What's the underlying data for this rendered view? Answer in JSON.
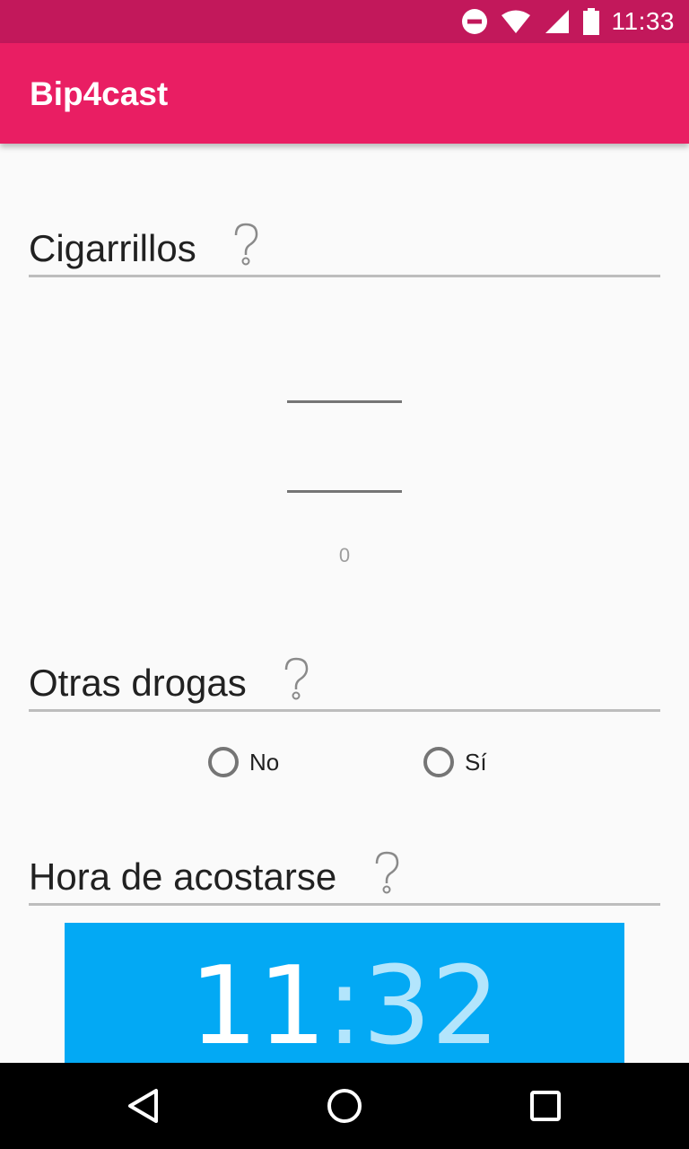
{
  "status_bar": {
    "time": "11:33",
    "icons": [
      "do-not-disturb-icon",
      "wifi-icon",
      "cell-signal-icon",
      "battery-icon"
    ]
  },
  "app_bar": {
    "title": "Bip4cast"
  },
  "sections": {
    "cigarrillos": {
      "title": "Cigarrillos",
      "help_icon": "help-icon",
      "picker_value": "0"
    },
    "otras_drogas": {
      "title": "Otras drogas",
      "help_icon": "help-icon",
      "options": [
        "No",
        "Sí"
      ],
      "selected": null
    },
    "hora_acostarse": {
      "title": "Hora de acostarse",
      "help_icon": "help-icon",
      "hour": "11",
      "separator": ":",
      "minute": "32"
    }
  },
  "colors": {
    "status_bar": "#c2185b",
    "app_bar": "#e91e63",
    "time_box": "#03a9f4"
  },
  "nav_bar": {
    "buttons": [
      "back-icon",
      "home-icon",
      "recents-icon"
    ]
  }
}
